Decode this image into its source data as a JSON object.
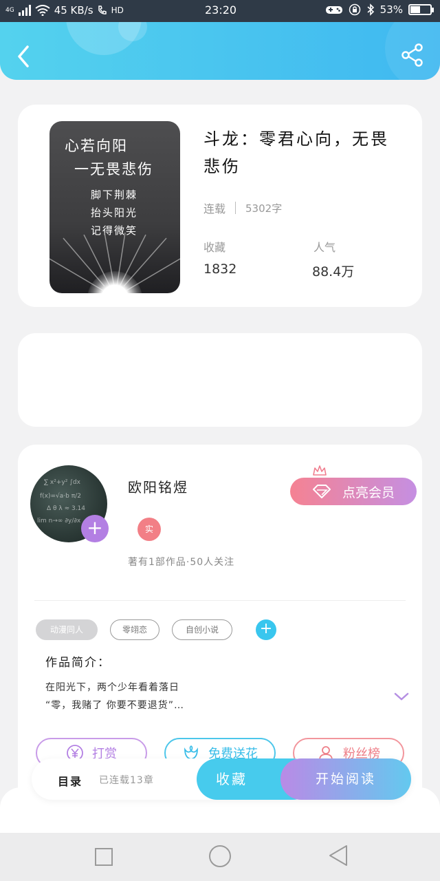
{
  "status_bar": {
    "network": "4G",
    "speed": "45 KB/s",
    "hd": "HD",
    "time": "23:20",
    "battery_percent_text": "53%",
    "battery_level": 0.53
  },
  "book": {
    "cover_lines": [
      "心若向阳",
      "一无畏悲伤",
      "脚下荆棘",
      "抬头阳光",
      "记得微笑"
    ],
    "title": "斗龙：零君心向，无畏悲伤",
    "status": "连载",
    "word_count": "5302字",
    "stats": {
      "favorites_label": "收藏",
      "favorites_value": "1832",
      "popularity_label": "人气",
      "popularity_value": "88.4万"
    }
  },
  "author": {
    "name": "欧阳铭煜",
    "verified_badge": "实",
    "meta": "著有1部作品·50人关注",
    "vip_button": "点亮会员",
    "tags": [
      "动漫同人",
      "零翊恋",
      "自创小说"
    ],
    "intro_title": "作品简介：",
    "intro_lines": [
      "在阳光下，两个少年看着落日",
      "“零，我赌了 你要不要退货”…"
    ],
    "actions": {
      "tip": "打赏",
      "flowers": "免费送花",
      "fans": "粉丝榜"
    }
  },
  "bottom_bar": {
    "toc_label": "目录",
    "toc_info": "已连载13章",
    "collect_button": "收藏",
    "read_button": "开始阅读"
  },
  "colors": {
    "header_start": "#54d2ee",
    "header_end": "#3fb8f0",
    "accent_blue": "#47cbed",
    "accent_purple": "#b37fe3",
    "accent_pink": "#f58292"
  }
}
